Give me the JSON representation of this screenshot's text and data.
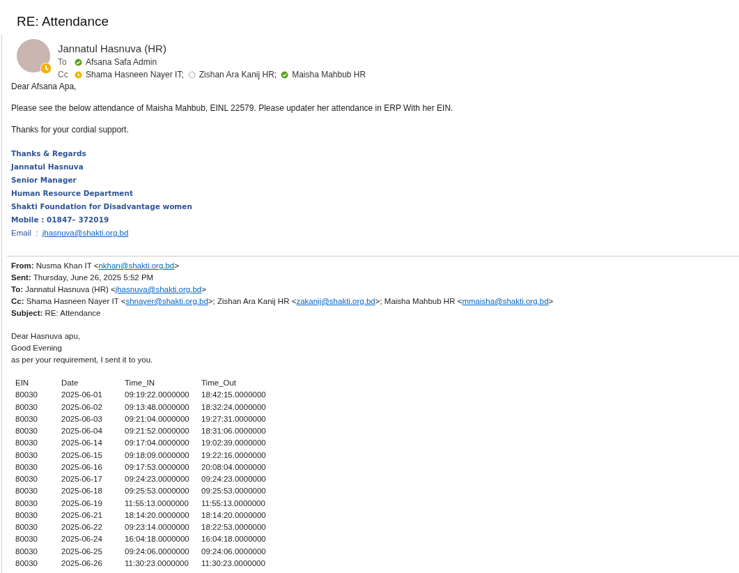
{
  "subject": "RE: Attendance",
  "sender": {
    "name": "Jannatul Hasnuva (HR)",
    "kind": "away"
  },
  "to": {
    "label": "To",
    "recipients": [
      {
        "name": "Afsana Safa Admin",
        "kind": "available"
      }
    ]
  },
  "cc": {
    "label": "Cc",
    "recipients": [
      {
        "name": "Shama Hasneen Nayer IT;",
        "kind": "away"
      },
      {
        "name": "Zishan Ara Kanij HR;",
        "kind": "offline"
      },
      {
        "name": "Maisha Mahbub HR",
        "kind": "available"
      }
    ]
  },
  "body": [
    "Dear Afsana Apa,",
    "Please see the below attendance of Maisha Mahbub, EINL 22579. Please updater her attendance in ERP With her EIN.",
    "Thanks for your cordial support."
  ],
  "signature": [
    {
      "kind": "bold",
      "text": "Thanks & Regards"
    },
    {
      "kind": "bold",
      "text": "Jannatul Hasnuva"
    },
    {
      "kind": "bold",
      "text": "Senior Manager"
    },
    {
      "kind": "bold",
      "text": "Human Resource Department"
    },
    {
      "kind": "bold",
      "text": "Shakti Foundation for Disadvantage women"
    },
    {
      "kind": "bold",
      "text": "Mobile : 01847– 372019"
    },
    {
      "kind": "email",
      "text": "Email  :  ",
      "link": "jhasnuva@shakti.org.bd"
    }
  ],
  "quoted_header": [
    {
      "label": "From:",
      "parts": [
        {
          "kind": "text",
          "text": "Nusma Khan IT <"
        },
        {
          "kind": "link",
          "text": "nkhan@shakti.org.bd"
        },
        {
          "kind": "text",
          "text": ">"
        }
      ]
    },
    {
      "label": "Sent:",
      "parts": [
        {
          "kind": "text",
          "text": "Thursday, June 26, 2025 5:52 PM"
        }
      ]
    },
    {
      "label": "To:",
      "parts": [
        {
          "kind": "text",
          "text": "Jannatul Hasnuva (HR) <"
        },
        {
          "kind": "link",
          "text": "jhasnuva@shakti.org.bd"
        },
        {
          "kind": "text",
          "text": ">"
        }
      ]
    },
    {
      "label": "Cc:",
      "parts": [
        {
          "kind": "text",
          "text": "Shama Hasneen Nayer IT <"
        },
        {
          "kind": "link",
          "text": "shnayer@shakti.org.bd"
        },
        {
          "kind": "text",
          "text": ">; Zishan Ara Kanij HR <"
        },
        {
          "kind": "link",
          "text": "zakanij@shakti.org.bd"
        },
        {
          "kind": "text",
          "text": ">; Maisha Mahbub HR <"
        },
        {
          "kind": "link",
          "text": "mmaisha@shakti.org.bd"
        },
        {
          "kind": "text",
          "text": ">"
        }
      ]
    },
    {
      "label": "Subject:",
      "parts": [
        {
          "kind": "text",
          "text": "RE: Attendance"
        }
      ]
    }
  ],
  "quoted_body": [
    "Dear Hasnuva apu,",
    "Good Evening",
    "as per your requirement, I sent it to you."
  ],
  "table": {
    "columns": [
      "EIN",
      "Date",
      "Time_IN",
      "Time_Out"
    ],
    "rows": [
      [
        "80030",
        "2025-06-01",
        "09:19:22.0000000",
        "18:42:15.0000000"
      ],
      [
        "80030",
        "2025-06-02",
        "09:13:48.0000000",
        "18:32:24.0000000"
      ],
      [
        "80030",
        "2025-06-03",
        "09:21:04.0000000",
        "19:27:31.0000000"
      ],
      [
        "80030",
        "2025-06-04",
        "09:21:52.0000000",
        "18:31:06.0000000"
      ],
      [
        "80030",
        "2025-06-14",
        "09:17:04.0000000",
        "19:02:39.0000000"
      ],
      [
        "80030",
        "2025-06-15",
        "09:18:09.0000000",
        "19:22:16.0000000"
      ],
      [
        "80030",
        "2025-06-16",
        "09:17:53.0000000",
        "20:08:04.0000000"
      ],
      [
        "80030",
        "2025-06-17",
        "09:24:23.0000000",
        "09:24:23.0000000"
      ],
      [
        "80030",
        "2025-06-18",
        "09:25:53.0000000",
        "09:25:53.0000000"
      ],
      [
        "80030",
        "2025-06-19",
        "11:55:13.0000000",
        "11:55:13.0000000"
      ],
      [
        "80030",
        "2025-06-21",
        "18:14:20.0000000",
        "18:14:20.0000000"
      ],
      [
        "80030",
        "2025-06-22",
        "09:23:14.0000000",
        "18:22:53.0000000"
      ],
      [
        "80030",
        "2025-06-24",
        "16:04:18.0000000",
        "16:04:18.0000000"
      ],
      [
        "80030",
        "2025-06-25",
        "09:24:06.0000000",
        "09:24:06.0000000"
      ],
      [
        "80030",
        "2025-06-26",
        "11:30:23.0000000",
        "11:30:23.0000000"
      ]
    ]
  }
}
